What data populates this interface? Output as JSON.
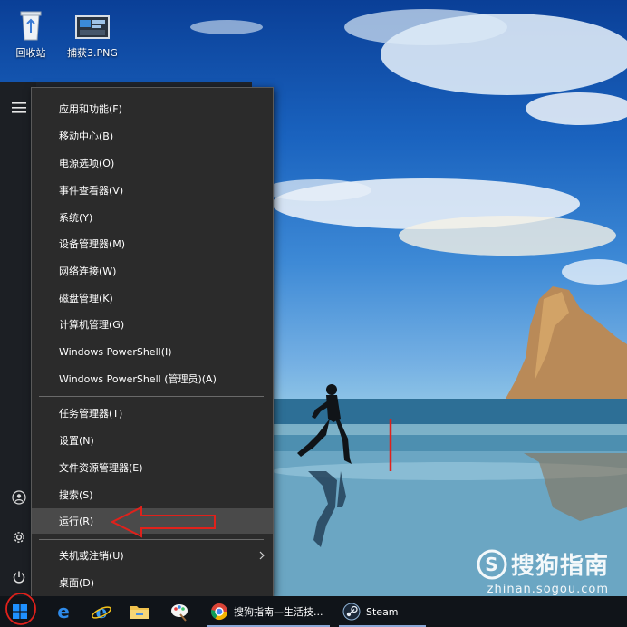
{
  "desktop": {
    "icons": [
      {
        "label": "回收站",
        "icon": "recycle-bin-icon"
      },
      {
        "label": "捕获3.PNG",
        "icon": "image-file-icon"
      }
    ]
  },
  "start_rail": {
    "icons": [
      "hamburger-menu-icon",
      "user-avatar-icon",
      "settings-gear-icon",
      "power-icon"
    ]
  },
  "winx_menu": {
    "group1": [
      "应用和功能(F)",
      "移动中心(B)",
      "电源选项(O)",
      "事件查看器(V)",
      "系统(Y)",
      "设备管理器(M)",
      "网络连接(W)",
      "磁盘管理(K)",
      "计算机管理(G)",
      "Windows PowerShell(I)",
      "Windows PowerShell (管理员)(A)"
    ],
    "group2": [
      "任务管理器(T)",
      "设置(N)",
      "文件资源管理器(E)",
      "搜索(S)",
      "运行(R)"
    ],
    "group3": [
      "关机或注销(U)",
      "桌面(D)"
    ],
    "highlighted": "运行(R)"
  },
  "taskbar": {
    "start_icon": "windows-logo-icon",
    "pinned": [
      "edge-icon",
      "internet-explorer-icon",
      "file-explorer-icon",
      "paint-icon"
    ],
    "apps": [
      {
        "label": "搜狗指南—生活技...",
        "icon": "chrome-icon"
      },
      {
        "label": "Steam",
        "icon": "steam-icon"
      }
    ]
  },
  "watermark": {
    "brand": "搜狗指南",
    "url": "zhinan.sogou.com"
  },
  "colors": {
    "menu_bg": "#2b2b2b",
    "menu_hover": "#4a4a4a",
    "taskbar_bg": "#101419",
    "annotation_red": "#e0211b"
  }
}
